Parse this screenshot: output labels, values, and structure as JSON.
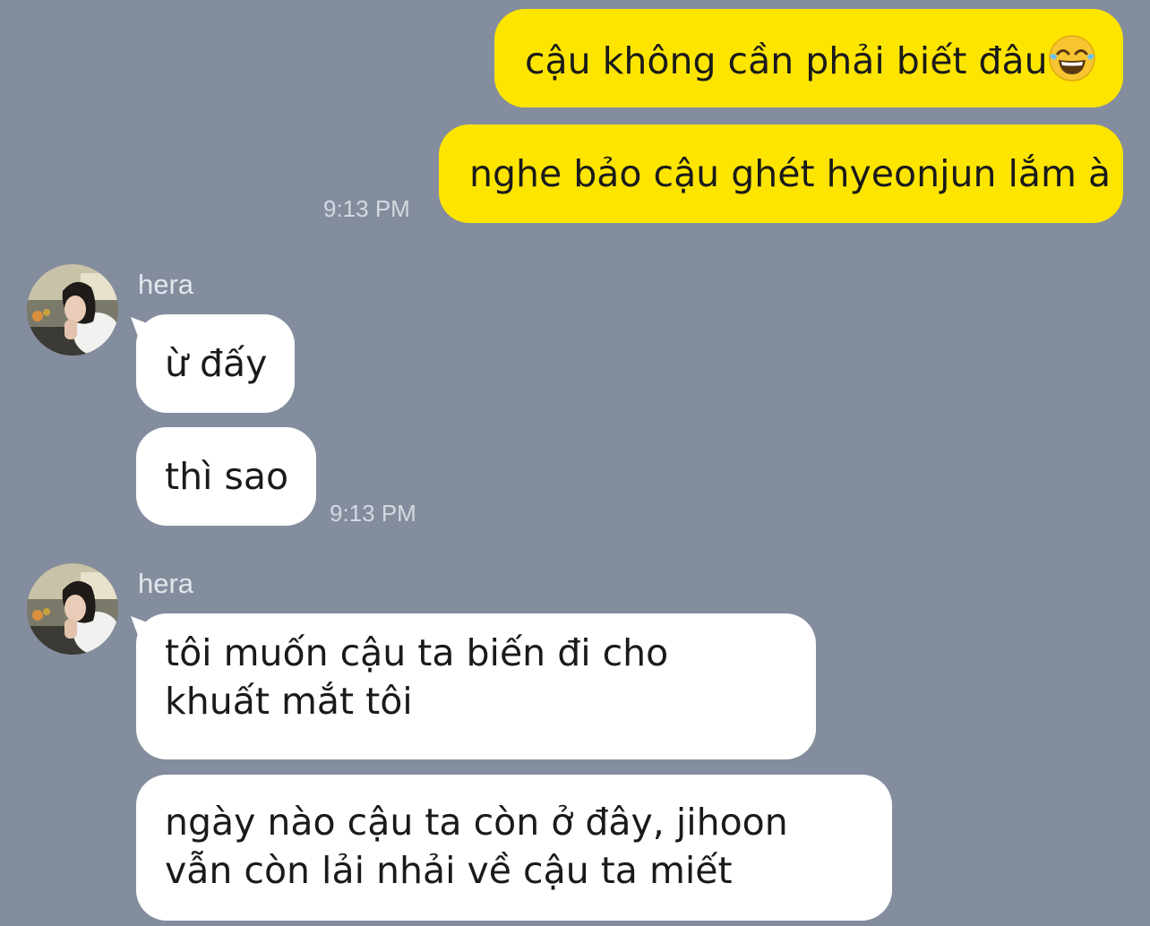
{
  "messages_sent": [
    {
      "text": "cậu không cần phải biết đâu",
      "emoji": "tears-of-joy-emoji"
    },
    {
      "text": "nghe bảo cậu ghét hyeonjun lắm à",
      "time": "9:13 PM"
    }
  ],
  "group1": {
    "sender": "hera",
    "messages": [
      "ừ đấy",
      "thì sao"
    ],
    "time": "9:13 PM"
  },
  "group2": {
    "sender": "hera",
    "messages": [
      "tôi muốn cậu ta biến đi cho khuất mắt tôi",
      "ngày nào cậu ta còn ở đây, jihoon vẫn còn lải nhải về cậu ta miết"
    ]
  },
  "colors": {
    "background": "#848d9e",
    "sent_bubble": "#fee500",
    "received_bubble": "#ffffff"
  }
}
